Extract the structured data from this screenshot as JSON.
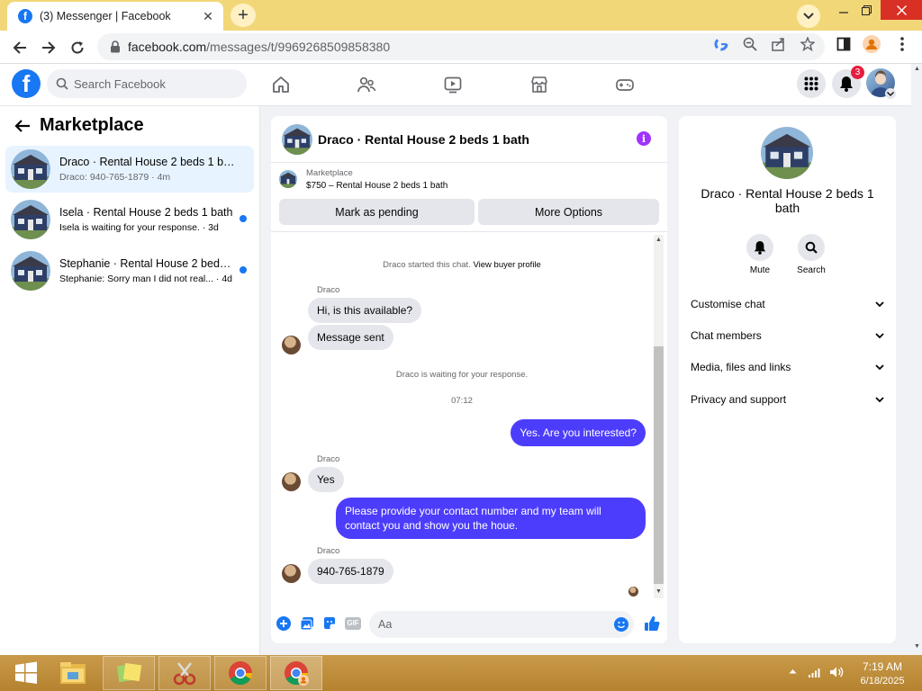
{
  "browser": {
    "tab_title": "(3) Messenger | Facebook",
    "tab_close": "✕",
    "new_tab": "+",
    "url_domain": "facebook.com",
    "url_path": "/messages/t/9969268509858380"
  },
  "fbnav": {
    "logo": "f",
    "search_placeholder": "Search Facebook",
    "notification_count": "3"
  },
  "left": {
    "title": "Marketplace",
    "chats": [
      {
        "name": "Draco · Rental House 2 beds 1 bath",
        "preview": "Draco: 940-765-1879 · 4m"
      },
      {
        "name": "Isela · Rental House 2 beds 1 bath",
        "preview": "Isela is waiting for your response. · 3d"
      },
      {
        "name": "Stephanie · Rental House 2 beds ...",
        "preview": "Stephanie: Sorry man I did not real... · 4d"
      }
    ]
  },
  "conversation": {
    "title": "Draco · Rental House 2 beds 1 bath",
    "info": "i",
    "marketplace_label": "Marketplace",
    "listing": "$750 – Rental House 2 beds 1 bath",
    "mark_pending": "Mark as pending",
    "more_options": "More Options",
    "started_text": "Draco started this chat.",
    "buyer_profile_link": "View buyer profile",
    "sender_name": "Draco",
    "msg1": "Hi, is this available?",
    "msg2": "Message sent",
    "waiting": "Draco is waiting for your response.",
    "time": "07:12",
    "msg3": "Yes. Are you interested?",
    "msg4": "Yes",
    "msg5": "Please provide your contact number and my team will contact you and show you the  houe.",
    "msg6": "940-765-1879",
    "input_placeholder": "Aa",
    "gif_label": "GIF"
  },
  "right": {
    "name": "Draco · Rental House 2 beds 1 bath",
    "mute": "Mute",
    "search": "Search",
    "rows": [
      "Customise chat",
      "Chat members",
      "Media, files and links",
      "Privacy and support"
    ]
  },
  "taskbar": {
    "time": "7:19 AM",
    "date": "6/18/2025"
  },
  "colors": {
    "brand": "#1877f2",
    "outgoing_bubble": "#4c3dfc",
    "unread_dot": "#1877f2",
    "info_icon": "#a033ff"
  }
}
